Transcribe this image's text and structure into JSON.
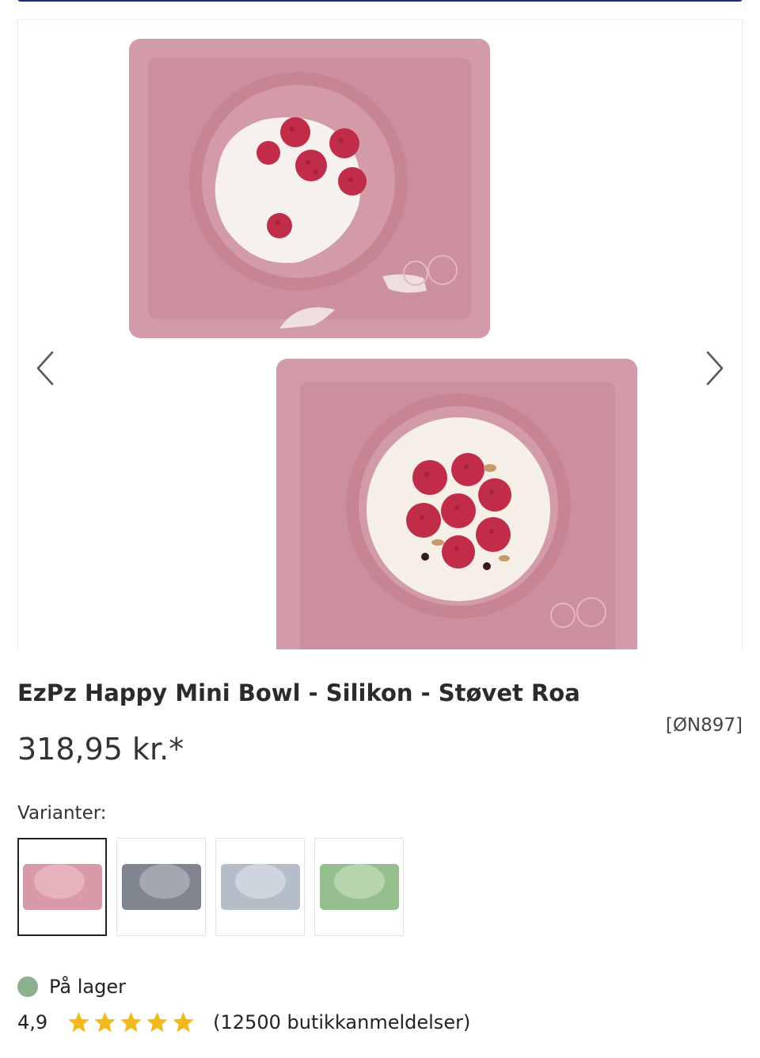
{
  "gallery": {
    "prev_icon": "chevron-left-icon",
    "next_icon": "chevron-right-icon",
    "colors": {
      "mat": "#d39aa7",
      "mat_inner": "#cc8f9d",
      "bowl_rim": "#c78594",
      "yogurt": "#f6f1ee",
      "raspberry": "#c12c48"
    }
  },
  "product": {
    "title": "EzPz Happy Mini Bowl - Silikon - Støvet Roa",
    "sku": "[ØN897]",
    "price": "318,95 kr.*"
  },
  "variants": {
    "label": "Varianter:",
    "items": [
      {
        "color": "#d79aa6",
        "bowl": "#e6b2bc",
        "selected": true
      },
      {
        "color": "#7f868f",
        "bowl": "#a2a8ae",
        "selected": false
      },
      {
        "color": "#b5bdc9",
        "bowl": "#cfd5dd",
        "selected": false
      },
      {
        "color": "#95bf8d",
        "bowl": "#b6d5ae",
        "selected": false
      }
    ]
  },
  "availability": {
    "text": "På lager",
    "dot_color": "#8db08e"
  },
  "rating": {
    "score": "4,9",
    "stars": 5,
    "star_color": "#f2b81e",
    "review_count": "(12500 butikkanmeldelser)"
  }
}
